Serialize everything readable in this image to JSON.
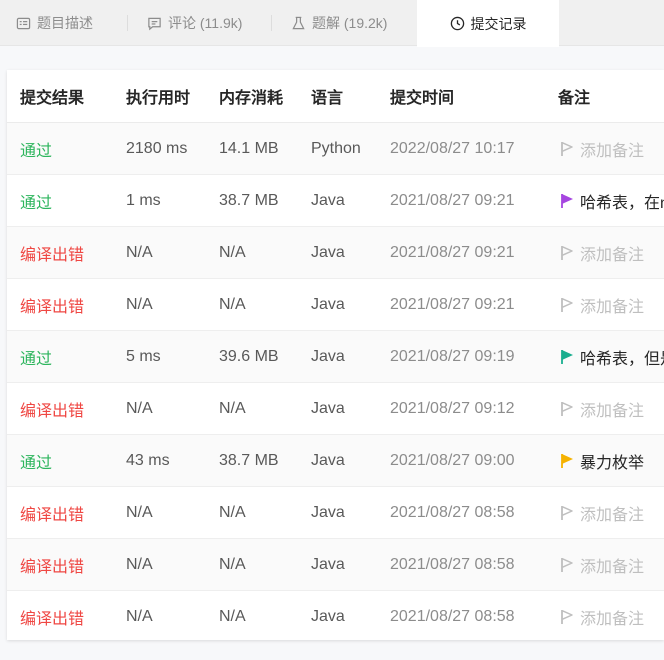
{
  "tabs": [
    {
      "label": "题目描述",
      "icon": "description-icon",
      "active": false
    },
    {
      "label": "评论 (11.9k)",
      "icon": "comment-icon",
      "active": false
    },
    {
      "label": "题解 (19.2k)",
      "icon": "flask-icon",
      "active": false
    },
    {
      "label": "提交记录",
      "icon": "clock-icon",
      "active": true
    }
  ],
  "table": {
    "headers": [
      "提交结果",
      "执行用时",
      "内存消耗",
      "语言",
      "提交时间",
      "备注"
    ],
    "rows": [
      {
        "status": "通过",
        "passed": true,
        "runtime": "2180 ms",
        "memory": "14.1 MB",
        "language": "Python",
        "time": "2022/08/27 10:17",
        "note": "添加备注",
        "flag_color": "#bfbfbf"
      },
      {
        "status": "通过",
        "passed": true,
        "runtime": "1 ms",
        "memory": "38.7 MB",
        "language": "Java",
        "time": "2021/08/27 09:21",
        "note": "哈希表，在m",
        "flag_color": "#a646e0"
      },
      {
        "status": "编译出错",
        "passed": false,
        "runtime": "N/A",
        "memory": "N/A",
        "language": "Java",
        "time": "2021/08/27 09:21",
        "note": "添加备注",
        "flag_color": "#bfbfbf"
      },
      {
        "status": "编译出错",
        "passed": false,
        "runtime": "N/A",
        "memory": "N/A",
        "language": "Java",
        "time": "2021/08/27 09:21",
        "note": "添加备注",
        "flag_color": "#bfbfbf"
      },
      {
        "status": "通过",
        "passed": true,
        "runtime": "5 ms",
        "memory": "39.6 MB",
        "language": "Java",
        "time": "2021/08/27 09:19",
        "note": "哈希表，但是",
        "flag_color": "#1aae8f"
      },
      {
        "status": "编译出错",
        "passed": false,
        "runtime": "N/A",
        "memory": "N/A",
        "language": "Java",
        "time": "2021/08/27 09:12",
        "note": "添加备注",
        "flag_color": "#bfbfbf"
      },
      {
        "status": "通过",
        "passed": true,
        "runtime": "43 ms",
        "memory": "38.7 MB",
        "language": "Java",
        "time": "2021/08/27 09:00",
        "note": "暴力枚举",
        "flag_color": "#f5b200"
      },
      {
        "status": "编译出错",
        "passed": false,
        "runtime": "N/A",
        "memory": "N/A",
        "language": "Java",
        "time": "2021/08/27 08:58",
        "note": "添加备注",
        "flag_color": "#bfbfbf"
      },
      {
        "status": "编译出错",
        "passed": false,
        "runtime": "N/A",
        "memory": "N/A",
        "language": "Java",
        "time": "2021/08/27 08:58",
        "note": "添加备注",
        "flag_color": "#bfbfbf"
      },
      {
        "status": "编译出错",
        "passed": false,
        "runtime": "N/A",
        "memory": "N/A",
        "language": "Java",
        "time": "2021/08/27 08:58",
        "note": "添加备注",
        "flag_color": "#bfbfbf"
      }
    ]
  }
}
